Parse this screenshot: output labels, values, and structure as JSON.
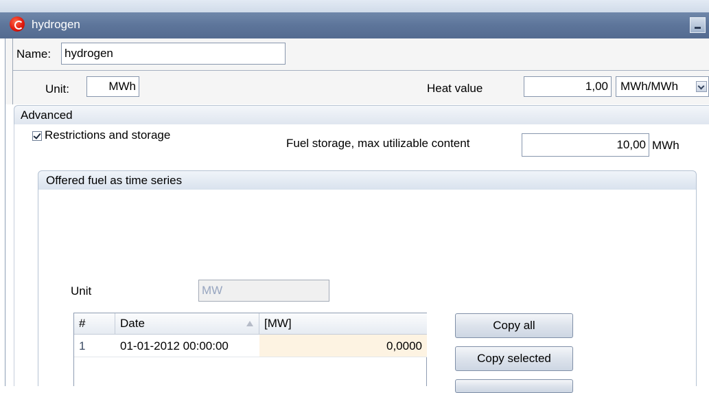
{
  "window": {
    "title": "hydrogen",
    "icon": "app-logo-icon"
  },
  "header": {
    "name_label": "Name:",
    "name_value": "hydrogen",
    "unit_label": "Unit:",
    "unit_value": "MWh",
    "heat_label": "Heat value",
    "heat_value": "1,00",
    "heat_unit": "MWh/MWh"
  },
  "advanced": {
    "title": "Advanced",
    "restrictions_label": "Restrictions and storage",
    "restrictions_checked": true,
    "storage_label": "Fuel storage, max utilizable content",
    "storage_value": "10,00",
    "storage_unit": "MWh"
  },
  "offered_fuel": {
    "title": "Offered fuel as time series",
    "unit_label": "Unit",
    "unit_value": "MW",
    "table": {
      "columns": [
        "#",
        "Date",
        "[MW]"
      ],
      "rows": [
        [
          "1",
          "01-01-2012 00:00:00",
          "0,0000"
        ]
      ]
    },
    "buttons": {
      "copy_all": "Copy all",
      "copy_selected": "Copy selected"
    }
  }
}
